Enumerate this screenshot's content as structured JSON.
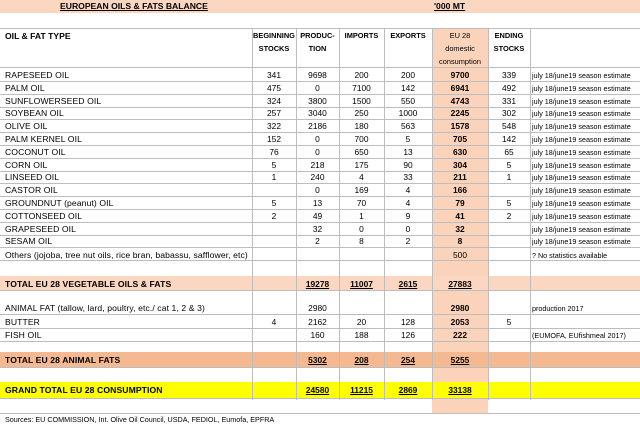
{
  "title": "EUROPEAN OILS & FATS BALANCE",
  "unit": "'000 MT",
  "headers": {
    "type": "OIL & FAT TYPE",
    "beginning": [
      "BEGINNING",
      "STOCKS"
    ],
    "production": [
      "PRODUC-",
      "TION"
    ],
    "imports": "IMPORTS",
    "exports": "EXPORTS",
    "domestic": [
      "EU 28",
      "domestic",
      "consumption"
    ],
    "ending": [
      "ENDING",
      "STOCKS"
    ]
  },
  "vegetable_rows": [
    {
      "name": "RAPESEED OIL",
      "beg": "341",
      "prod": "9698",
      "imp": "200",
      "exp": "200",
      "dom": "9700",
      "end": "339",
      "note": "july 18/june19 season estimate"
    },
    {
      "name": "PALM OIL",
      "beg": "475",
      "prod": "0",
      "imp": "7100",
      "exp": "142",
      "dom": "6941",
      "end": "492",
      "note": "july 18/june19 season estimate"
    },
    {
      "name": "SUNFLOWERSEED OIL",
      "beg": "324",
      "prod": "3800",
      "imp": "1500",
      "exp": "550",
      "dom": "4743",
      "end": "331",
      "note": "july 18/june19 season estimate"
    },
    {
      "name": "SOYBEAN OIL",
      "beg": "257",
      "prod": "3040",
      "imp": "250",
      "exp": "1000",
      "dom": "2245",
      "end": "302",
      "note": "july 18/june19 season estimate"
    },
    {
      "name": "OLIVE OIL",
      "beg": "322",
      "prod": "2186",
      "imp": "180",
      "exp": "563",
      "dom": "1578",
      "end": "548",
      "note": "july 18/june19 season estimate"
    },
    {
      "name": "PALM KERNEL OIL",
      "beg": "152",
      "prod": "0",
      "imp": "700",
      "exp": "5",
      "dom": "705",
      "end": "142",
      "note": "july 18/june19 season estimate"
    },
    {
      "name": "COCONUT OIL",
      "beg": "76",
      "prod": "0",
      "imp": "650",
      "exp": "13",
      "dom": "630",
      "end": "65",
      "note": "july 18/june19 season estimate"
    },
    {
      "name": "CORN OIL",
      "beg": "5",
      "prod": "218",
      "imp": "175",
      "exp": "90",
      "dom": "304",
      "end": "5",
      "note": "july 18/june19 season estimate"
    },
    {
      "name": "LINSEED OIL",
      "beg": "1",
      "prod": "240",
      "imp": "4",
      "exp": "33",
      "dom": "211",
      "end": "1",
      "note": "july 18/june19 season estimate"
    },
    {
      "name": "CASTOR OIL",
      "beg": "",
      "prod": "0",
      "imp": "169",
      "exp": "4",
      "dom": "166",
      "end": "",
      "note": "july 18/june19 season estimate"
    },
    {
      "name": "GROUNDNUT (peanut) OIL",
      "beg": "5",
      "prod": "13",
      "imp": "70",
      "exp": "4",
      "dom": "79",
      "end": "5",
      "note": "july 18/june19 season estimate"
    },
    {
      "name": "COTTONSEED OIL",
      "beg": "2",
      "prod": "49",
      "imp": "1",
      "exp": "9",
      "dom": "41",
      "end": "2",
      "note": "july 18/june19 season estimate"
    },
    {
      "name": "GRAPESEED OIL",
      "beg": "",
      "prod": "32",
      "imp": "0",
      "exp": "0",
      "dom": "32",
      "end": "",
      "note": "july 18/june19 season estimate"
    },
    {
      "name": "SESAM OIL",
      "beg": "",
      "prod": "2",
      "imp": "8",
      "exp": "2",
      "dom": "8",
      "end": "",
      "note": "july 18/june19 season estimate"
    }
  ],
  "others": {
    "name": "Others (jojoba, tree nut oils, rice bran, babassu, safflower, etc)",
    "dom": "500",
    "note": "? No statistics available"
  },
  "total_veg": {
    "name": "TOTAL EU 28 VEGETABLE OILS & FATS",
    "prod": "19278",
    "imp": "11007",
    "exp": "2615",
    "dom": "27883"
  },
  "animal_rows": [
    {
      "name": "ANIMAL FAT (tallow, lard, poultry, etc./ cat 1, 2 & 3)",
      "beg": "",
      "prod": "2980",
      "imp": "",
      "exp": "",
      "dom": "2980",
      "end": "",
      "note": "production 2017"
    },
    {
      "name": "BUTTER",
      "beg": "4",
      "prod": "2162",
      "imp": "20",
      "exp": "128",
      "dom": "2053",
      "end": "5",
      "note": ""
    },
    {
      "name": "FISH OIL",
      "beg": "",
      "prod": "160",
      "imp": "188",
      "exp": "126",
      "dom": "222",
      "end": "",
      "note": "(EUMOFA, EUfishmeal 2017)"
    }
  ],
  "total_animal": {
    "name": "TOTAL EU 28 ANIMAL FATS",
    "prod": "5302",
    "imp": "208",
    "exp": "254",
    "dom": "5255"
  },
  "grand_total": {
    "name": "GRAND TOTAL EU 28 CONSUMPTION",
    "prod": "24580",
    "imp": "11215",
    "exp": "2869",
    "dom": "33138"
  },
  "sources": "Sources: EU COMMISSION, Int. Olive Oil Council, USDA, FEDIOL, Eumofa, EPFRA",
  "colors": {
    "banner": "#fbd7c1",
    "domestic_column": "#fbd3bb",
    "total_band": "#f4b990",
    "grand_band": "#ffff00"
  }
}
